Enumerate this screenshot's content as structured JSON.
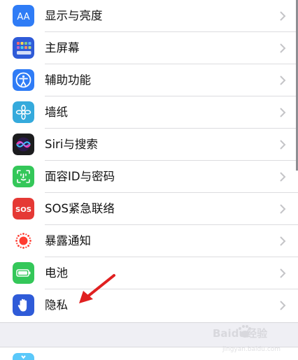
{
  "settings": {
    "items": [
      {
        "label": "显示与亮度",
        "icon": "display-brightness-icon",
        "color": "#2F7CF6"
      },
      {
        "label": "主屏幕",
        "icon": "home-screen-icon",
        "color": "#2F5BD8"
      },
      {
        "label": "辅助功能",
        "icon": "accessibility-icon",
        "color": "#2F7CF6"
      },
      {
        "label": "墙纸",
        "icon": "wallpaper-icon",
        "color": "#35AADC"
      },
      {
        "label": "Siri与搜索",
        "icon": "siri-icon",
        "color": "#1C1C1E"
      },
      {
        "label": "面容ID与密码",
        "icon": "face-id-icon",
        "color": "#34C759"
      },
      {
        "label": "SOS紧急联络",
        "icon": "sos-icon",
        "color": "#E53935"
      },
      {
        "label": "暴露通知",
        "icon": "exposure-notification-icon",
        "color": "#FF3B30"
      },
      {
        "label": "电池",
        "icon": "battery-icon",
        "color": "#34C759"
      },
      {
        "label": "隐私",
        "icon": "privacy-hand-icon",
        "color": "#2F5BD8"
      }
    ],
    "icon_text": {
      "display": "AA",
      "sos": "SOS"
    }
  },
  "watermark": {
    "brand": "Baidu经验",
    "sub": "jingyan.baidu.com"
  },
  "annotation": {
    "arrow_color": "#E02020"
  }
}
